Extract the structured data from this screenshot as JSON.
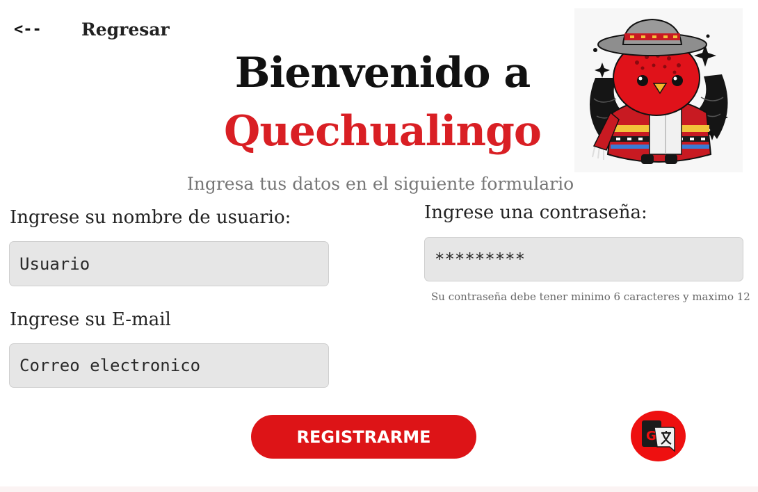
{
  "nav": {
    "back_arrow": "<--",
    "back_label": "Regresar"
  },
  "header": {
    "title_line1": "Bienvenido a",
    "title_line2": "Quechualingo",
    "subtitle": "Ingresa tus datos en el siguiente formulario"
  },
  "form": {
    "username": {
      "label": "Ingrese su nombre de usuario:",
      "placeholder": "Usuario"
    },
    "email": {
      "label": "Ingrese su E-mail",
      "placeholder": "Correo electronico"
    },
    "password": {
      "label": "Ingrese una contraseña:",
      "placeholder": "*********",
      "hint": "Su contraseña debe tener minimo 6 caracteres y maximo 12"
    },
    "submit_label": "REGISTRARME"
  },
  "colors": {
    "brand_red": "#dd1417",
    "title_red": "#d91f24",
    "input_bg": "#e6e6e6"
  },
  "icons": {
    "mascot": "quechua-bird-mascot",
    "translate": "google-translate-icon"
  }
}
